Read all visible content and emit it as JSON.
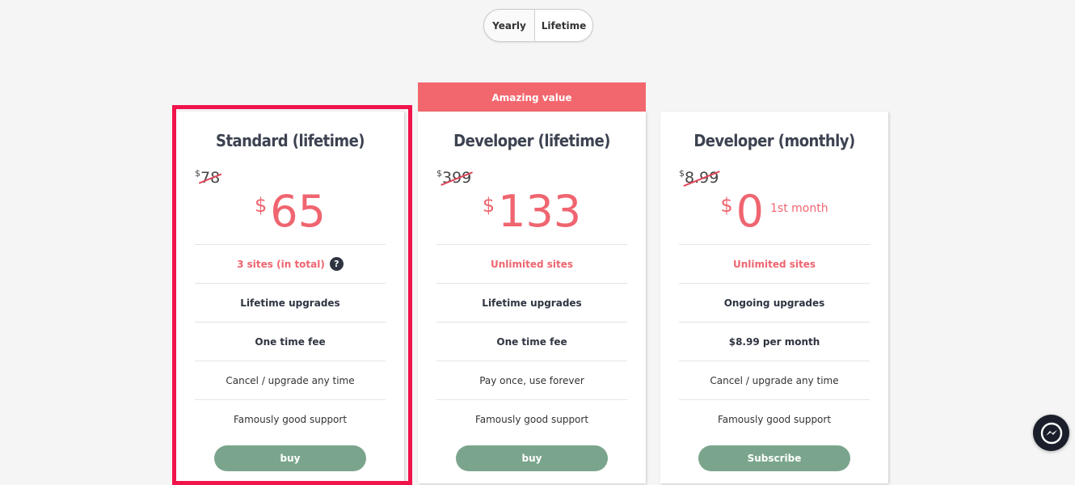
{
  "billing_toggle": {
    "options": [
      "Yearly",
      "Lifetime"
    ],
    "selected": "Lifetime"
  },
  "plans": [
    {
      "title": "Standard (lifetime)",
      "currency": "$",
      "old_price": "78",
      "price": "65",
      "price_suffix": "",
      "features": [
        "3 sites (in total)",
        "Lifetime upgrades",
        "One time fee",
        "Cancel / upgrade any time",
        "Famously good support"
      ],
      "button": "buy",
      "highlighted": true
    },
    {
      "ribbon": "Amazing value",
      "title": "Developer (lifetime)",
      "currency": "$",
      "old_price": "399",
      "price": "133",
      "price_suffix": "",
      "features": [
        "Unlimited sites",
        "Lifetime upgrades",
        "One time fee",
        "Pay once, use forever",
        "Famously good support"
      ],
      "button": "buy"
    },
    {
      "title": "Developer (monthly)",
      "currency": "$",
      "old_price": "8.99",
      "price": "0",
      "price_suffix": "1st month",
      "features": [
        "Unlimited sites",
        "Ongoing upgrades",
        "$8.99 per month",
        "Cancel / upgrade any time",
        "Famously good support"
      ],
      "button": "Subscribe"
    }
  ],
  "help_icon_glyph": "?",
  "colors": {
    "accent": "#ef6570",
    "highlight_border": "#f0144b",
    "button": "#7aa58c",
    "ribbon": "#f2676e"
  },
  "icons": {
    "help": "question-circle-icon",
    "chat": "messenger-icon"
  }
}
